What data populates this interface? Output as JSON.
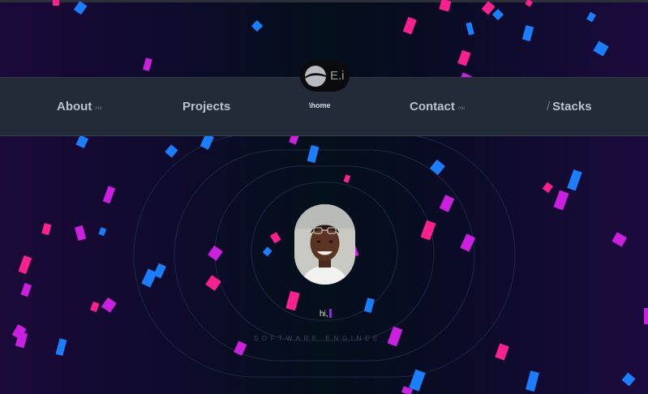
{
  "nav": {
    "about": {
      "label": "About",
      "sub": "me"
    },
    "projects": {
      "label": "Projects"
    },
    "home": {
      "label": "\\home"
    },
    "contact": {
      "label": "Contact",
      "sub": "me"
    },
    "stacks": {
      "slash": "/",
      "label": "Stacks"
    }
  },
  "logo": {
    "text": "E.i",
    "icon": "swoosh-logo-icon"
  },
  "hero": {
    "greeting": "hi,",
    "cursor": "|",
    "role": "SOFTWARE ENGINEE"
  },
  "colors": {
    "pink": "#ff1f8e",
    "magenta": "#cc1fe0",
    "blue": "#1a7fff",
    "navbar": "#222b37",
    "accent_cursor": "#8a2be2"
  }
}
